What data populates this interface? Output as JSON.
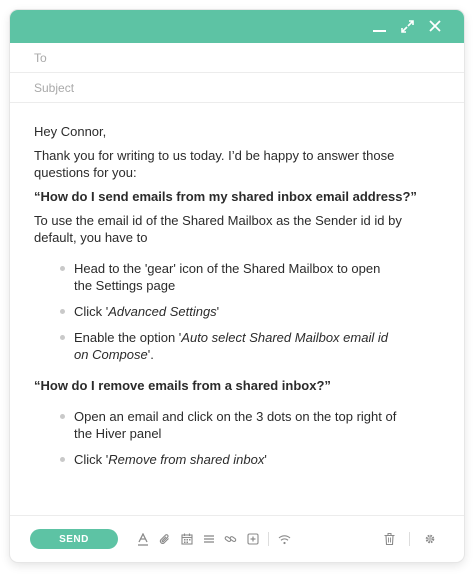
{
  "compose": {
    "to_placeholder": "To",
    "subject_placeholder": "Subject"
  },
  "message": {
    "greeting": "Hey Connor,",
    "intro": "Thank you for writing to us today. I’d be happy to answer those questions for you:",
    "q1": "“How do I send emails from my shared inbox email address?”",
    "a1_intro": "To use the email id of the Shared Mailbox as the Sender id id by default, you have to",
    "steps1": [
      {
        "text": "Head to the 'gear' icon of the Shared Mailbox to open the Settings page"
      },
      {
        "pre": "Click '",
        "em": "Advanced Settings",
        "post": "'"
      },
      {
        "pre": "Enable the option '",
        "em": "Auto select Shared Mailbox email id on Compose",
        "post": "'."
      }
    ],
    "q2": "“How do I remove emails from a shared inbox?”",
    "steps2": [
      {
        "text": "Open an email and click on the 3 dots on the top right of the Hiver panel"
      },
      {
        "pre": "Click '",
        "em": "Remove from shared inbox",
        "post": "'"
      }
    ]
  },
  "toolbar": {
    "send_label": "SEND",
    "icons": [
      "text-format-icon",
      "attachment-icon",
      "calendar-icon",
      "list-icon",
      "link-icon",
      "insert-icon",
      "wifi-icon",
      "trash-icon",
      "gear-icon"
    ]
  },
  "colors": {
    "accent": "#5dc3a4",
    "text": "#2b2b2b",
    "placeholder": "#a9a9a9",
    "icon": "#8a8a8a"
  }
}
